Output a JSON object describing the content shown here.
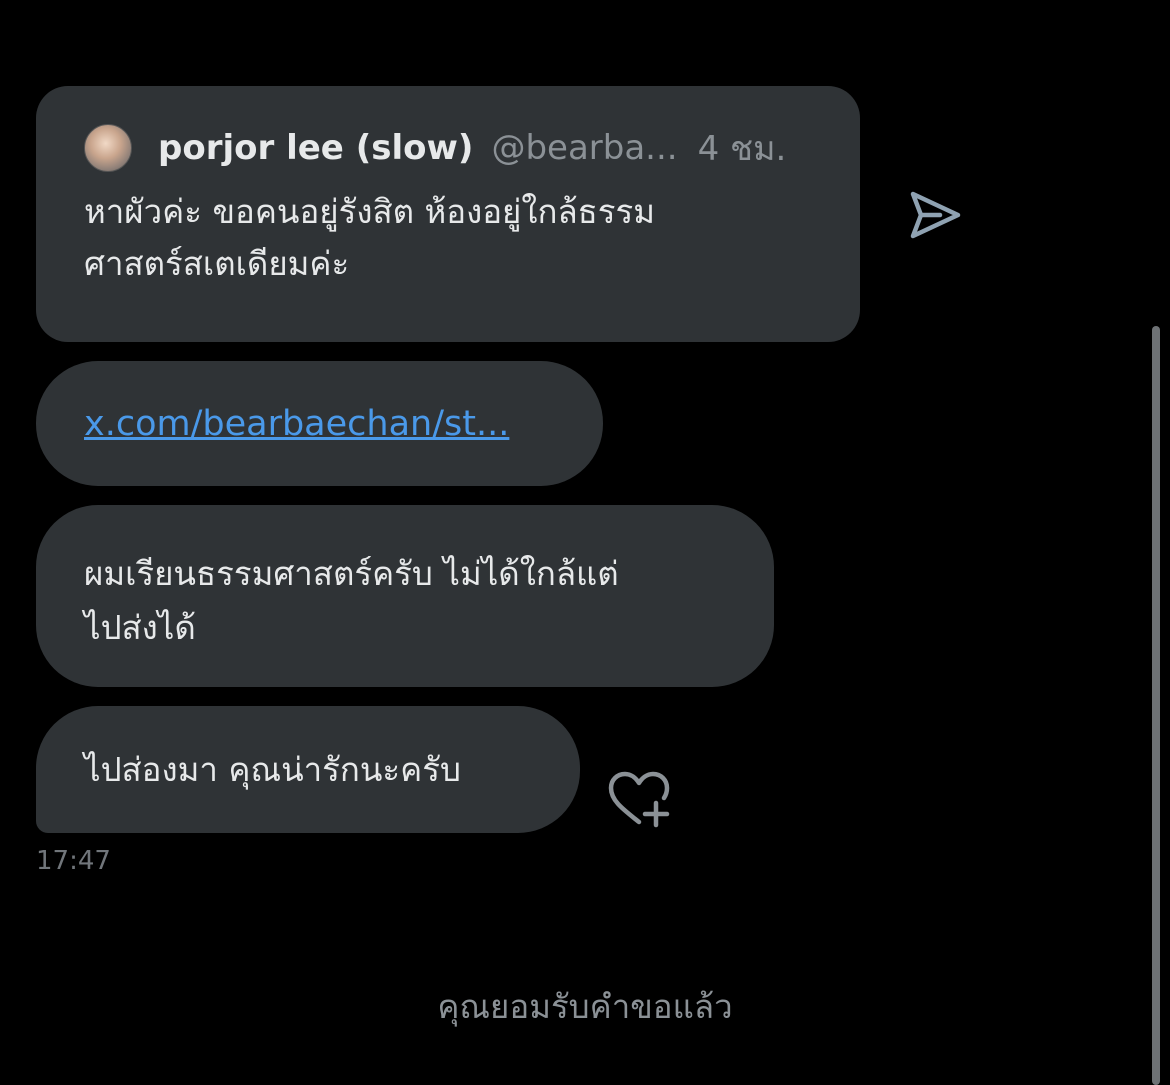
{
  "quoted_post": {
    "author_name": "porjor lee (slow)",
    "author_handle": "@bearba...",
    "time": "4 ชม.",
    "text_line1": "หาผัวค่ะ ขอคนอยู่รังสิต ห้องอยู่ใกล้ธรรม",
    "text_line2": "ศาสตร์สเตเดียมค่ะ"
  },
  "link_message": {
    "url_text": "x.com/bearbaechan/st..."
  },
  "messages": [
    {
      "line1": "ผมเรียนธรรมศาสตร์ครับ ไม่ได้ใกล้แต่",
      "line2": "ไปส่งได้"
    },
    {
      "text": "ไปส่องมา คุณน่ารักนะครับ"
    }
  ],
  "timestamp": "17:47",
  "status_text": "คุณยอมรับคำขอแล้ว",
  "icons": {
    "share": "share-icon",
    "react": "heart-plus-icon",
    "avatar": "avatar"
  },
  "colors": {
    "background": "#000000",
    "bubble": "#2f3336",
    "link": "#4a99e9",
    "muted": "#8b9196"
  }
}
